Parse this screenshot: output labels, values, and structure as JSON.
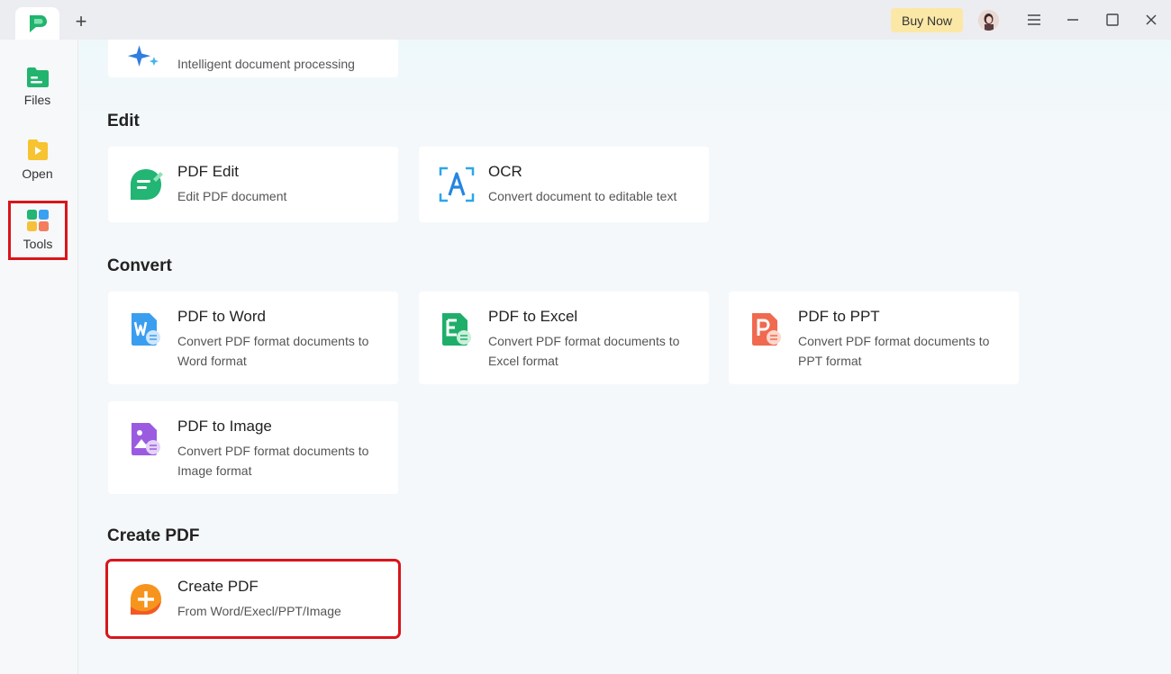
{
  "titlebar": {
    "add_tab_label": "+",
    "buy_now_label": "Buy Now"
  },
  "sidebar": {
    "items": [
      {
        "label": "Files",
        "icon": "files-icon"
      },
      {
        "label": "Open",
        "icon": "open-icon"
      },
      {
        "label": "Tools",
        "icon": "tools-icon",
        "active": true
      }
    ]
  },
  "top_card": {
    "desc": "Intelligent document processing"
  },
  "sections": {
    "edit": {
      "title": "Edit",
      "cards": [
        {
          "title": "PDF Edit",
          "desc": "Edit PDF document"
        },
        {
          "title": "OCR",
          "desc": "Convert document to editable text"
        }
      ]
    },
    "convert": {
      "title": "Convert",
      "cards": [
        {
          "title": "PDF to Word",
          "desc": "Convert PDF format documents to Word format"
        },
        {
          "title": "PDF to Excel",
          "desc": "Convert PDF format documents to Excel format"
        },
        {
          "title": "PDF to PPT",
          "desc": "Convert PDF format documents to PPT format"
        },
        {
          "title": "PDF to Image",
          "desc": "Convert PDF format documents to Image format"
        }
      ]
    },
    "create": {
      "title": "Create PDF",
      "cards": [
        {
          "title": "Create PDF",
          "desc": "From Word/Execl/PPT/Image"
        }
      ]
    }
  },
  "colors": {
    "accent_green": "#22b573",
    "highlight_red": "#d9151b",
    "buy_now_bg": "#fbe8a6"
  }
}
